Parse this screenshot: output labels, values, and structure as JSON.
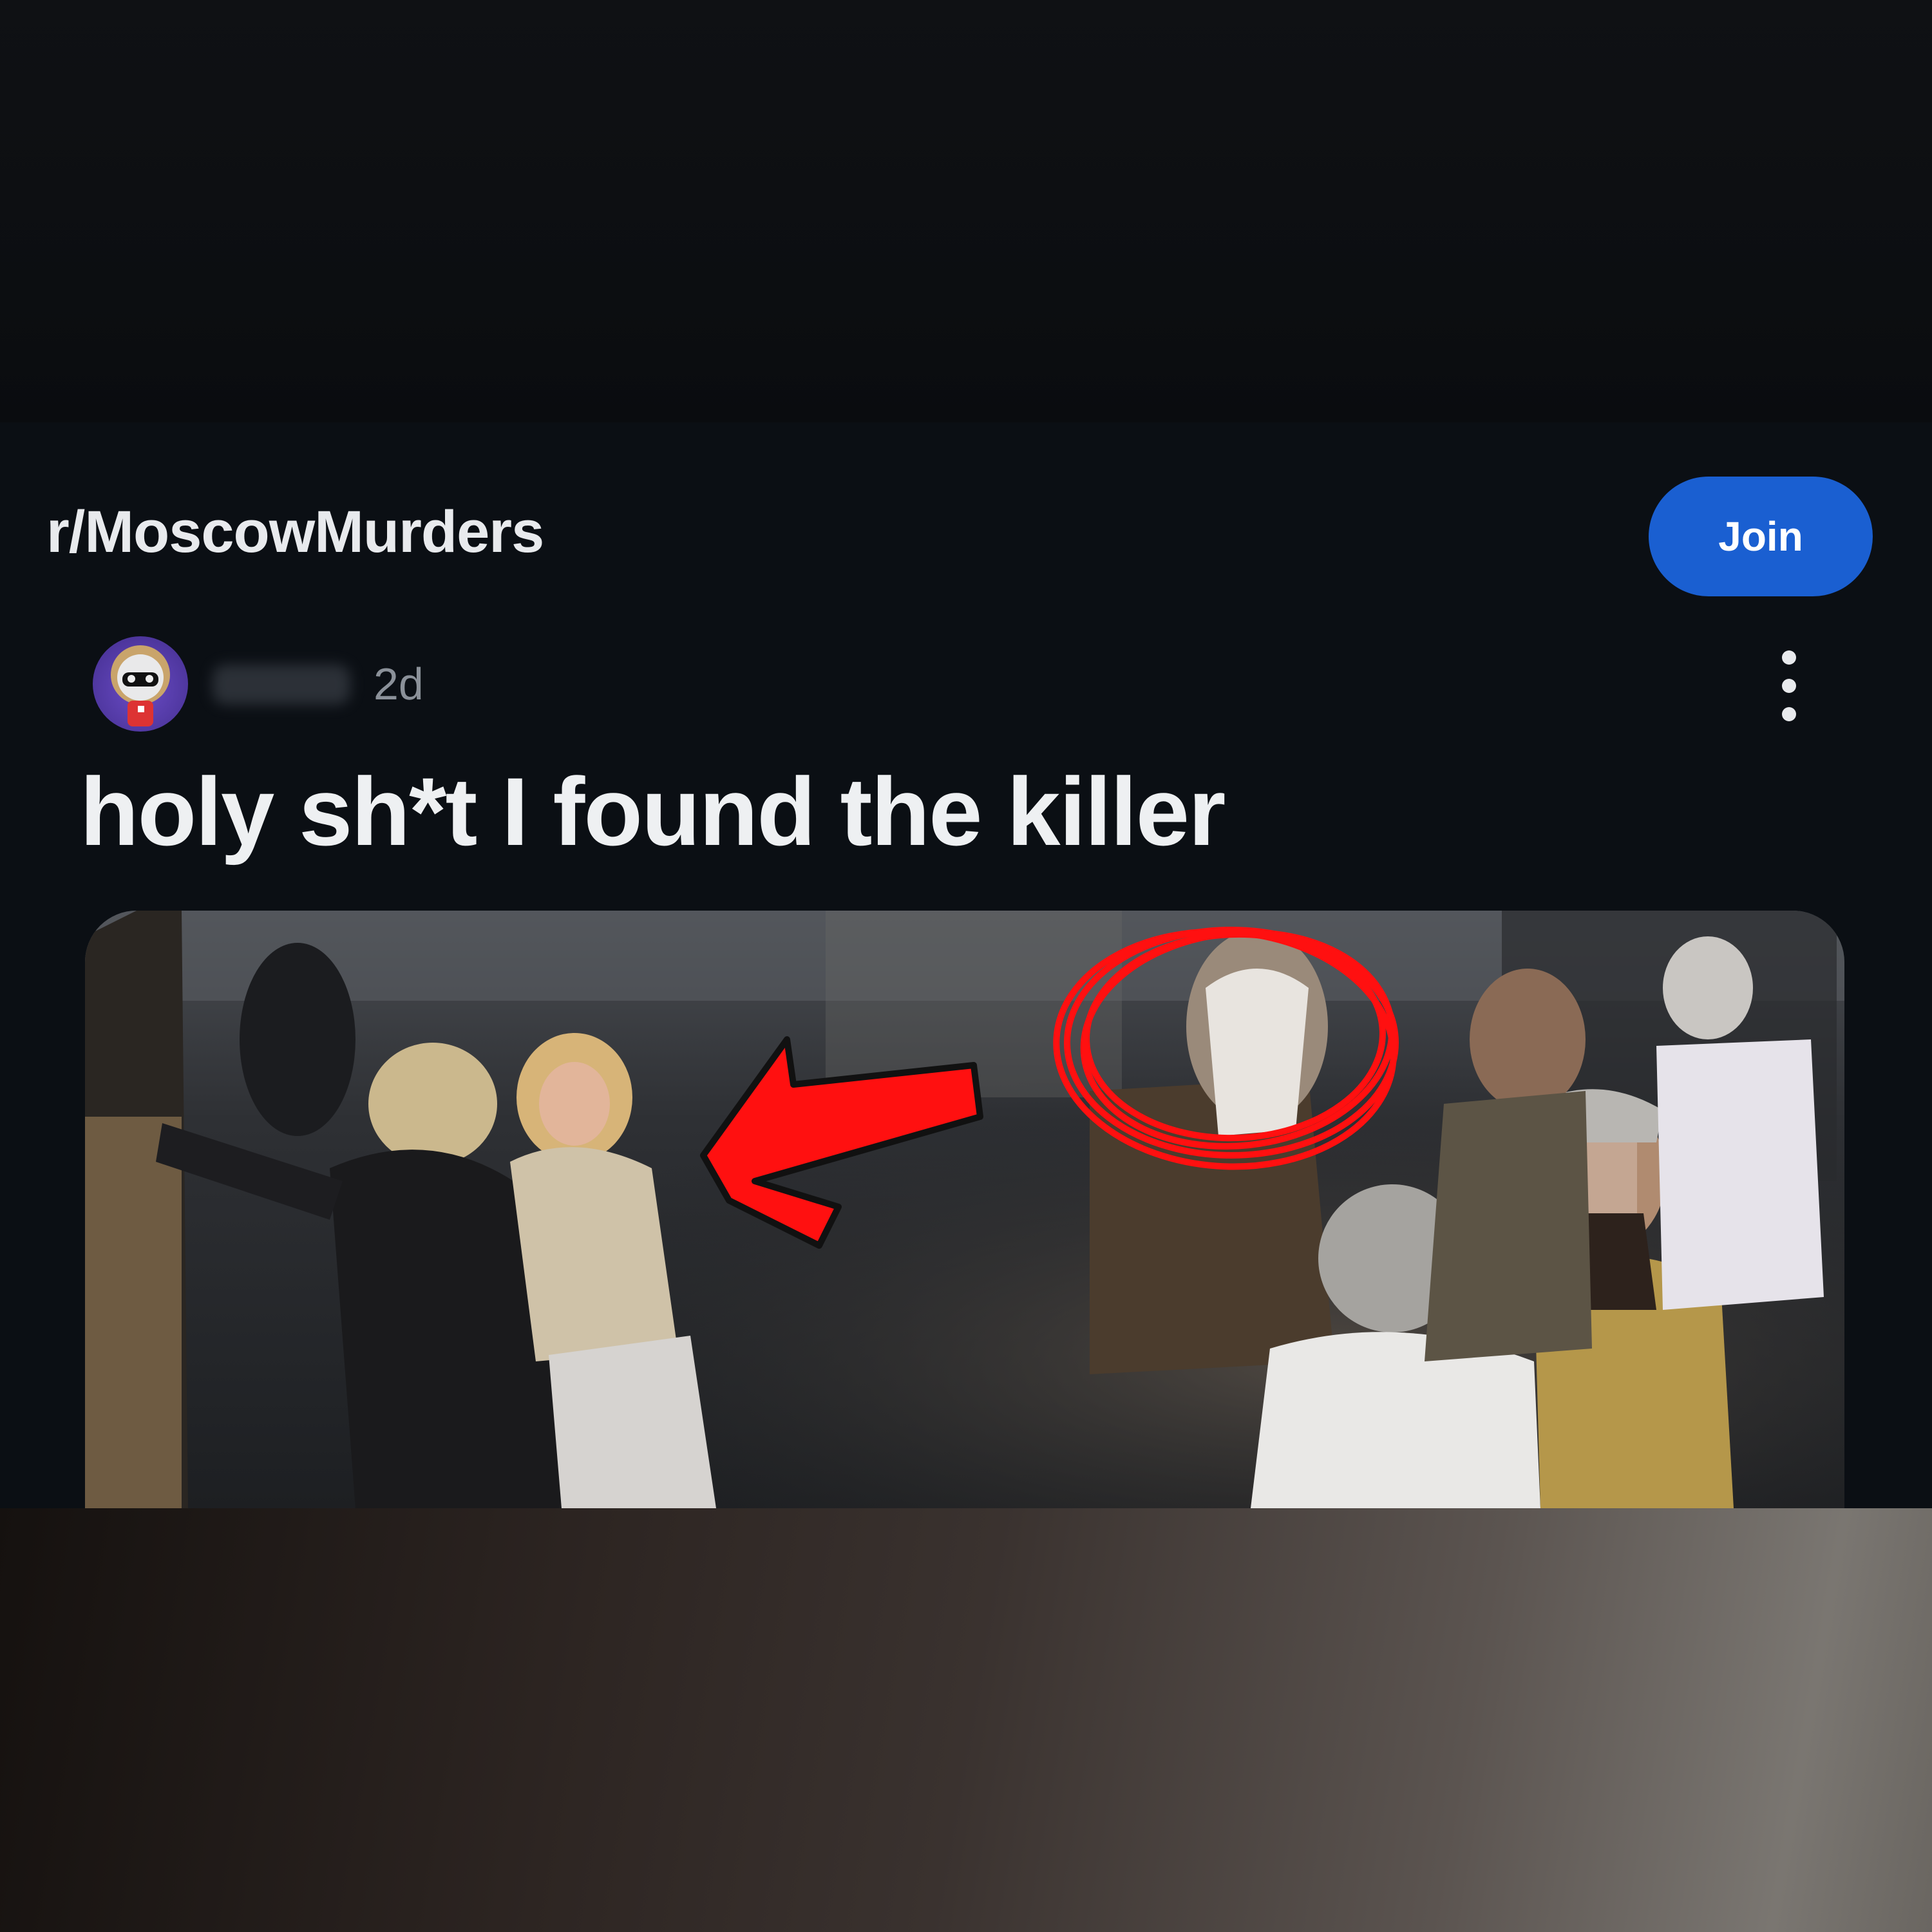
{
  "subreddit": {
    "name": "r/MoscowMurders",
    "join_label": "Join"
  },
  "post": {
    "username": "",
    "time": "2d",
    "title": "holy sh*t I found the killer"
  },
  "icons": {
    "avatar": "astronaut-snoo-avatar",
    "more": "vertical-ellipsis-icon",
    "annotation_arrow": "red-arrow",
    "annotation_circle": "red-scribble-circle"
  },
  "colors": {
    "join_button": "#1a5fd1",
    "annotation": "#ff0000",
    "background": "#0b0f14"
  }
}
